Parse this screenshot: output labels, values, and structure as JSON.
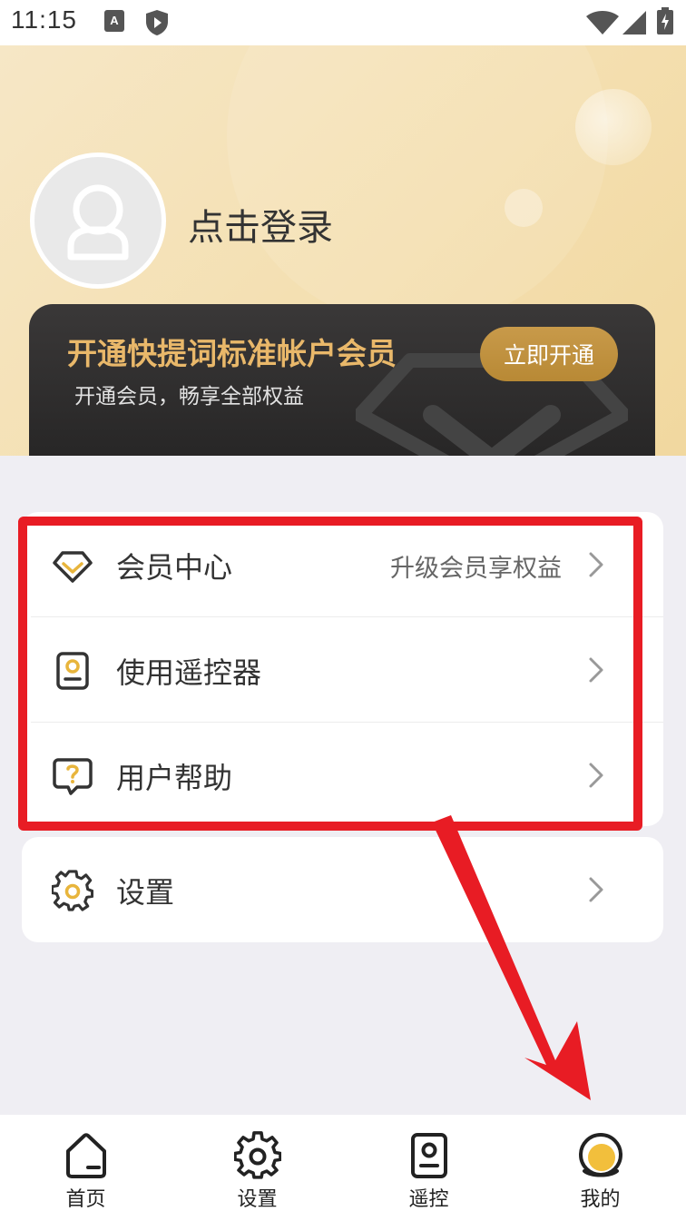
{
  "status_bar": {
    "time": "11:15"
  },
  "header": {
    "login_text": "点击登录"
  },
  "vip_card": {
    "title": "开通快提词标准帐户会员",
    "subtitle": "开通会员，畅享全部权益",
    "button_label": "立即开通"
  },
  "menu": {
    "items": [
      {
        "label": "会员中心",
        "extra": "升级会员享权益"
      },
      {
        "label": "使用遥控器"
      },
      {
        "label": "用户帮助"
      }
    ]
  },
  "settings_card": {
    "label": "设置"
  },
  "tabbar": {
    "tabs": [
      {
        "label": "首页"
      },
      {
        "label": "设置"
      },
      {
        "label": "遥控"
      },
      {
        "label": "我的"
      }
    ],
    "active_index": 3
  },
  "colors": {
    "accent_gold": "#b88935",
    "highlight_red": "#e81c24",
    "dark_card": "#2a2929"
  }
}
